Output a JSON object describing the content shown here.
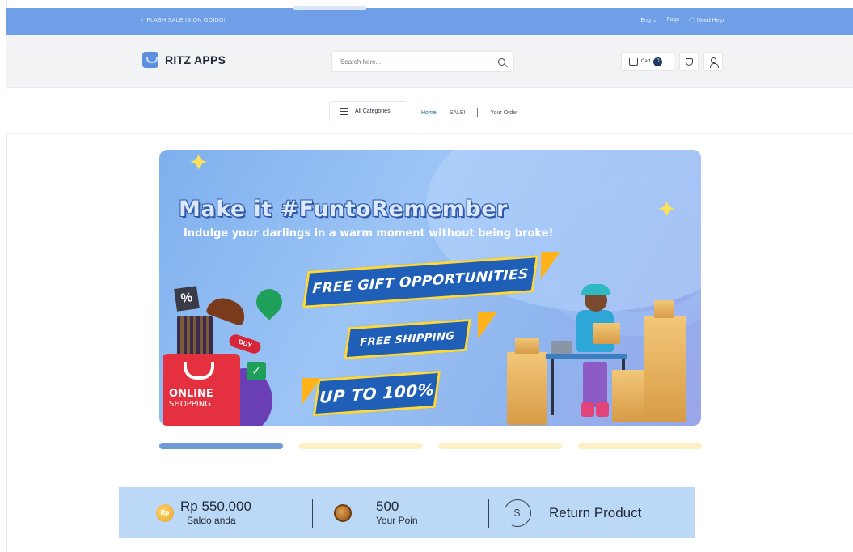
{
  "topbar": {
    "promo": "✓ FLASH SALE IS ON GOING!",
    "language": "Eng ⌄",
    "faqs": "Faqs",
    "help": "◯ Need Help"
  },
  "header": {
    "brand": "RITZ APPS",
    "search_placeholder": "Search here...",
    "cart_label": "Cart",
    "cart_count": "0"
  },
  "nav": {
    "all_categories": "All Categories",
    "links": [
      "Home",
      "SALE!",
      "Your Order"
    ]
  },
  "banner": {
    "headline": "Make it #FuntoRemember",
    "subline": "Indulge your darlings in a warm moment without being broke!",
    "ribbons": [
      "FREE GIFT OPPORTUNITIES",
      "FREE SHIPPING",
      "UP TO 100%"
    ],
    "bag_line1": "ONLINE",
    "bag_line2": "SHOPPING",
    "percent_tag": "%",
    "buy_tag": "BUY"
  },
  "carousel": {
    "slides": 4,
    "active_index": 0
  },
  "infobar": {
    "balance_amount": "Rp 550.000",
    "balance_label": "Saldo anda",
    "balance_coin": "Rp",
    "points_amount": "500",
    "points_label": "Your Poin",
    "return_label": "Return Product",
    "return_symbol": "$"
  },
  "colors": {
    "topbar": "#6f9fe6",
    "accent": "#6d9bd6",
    "infobar": "#bcd8f7",
    "indicator_inactive": "#fdf0c6"
  }
}
